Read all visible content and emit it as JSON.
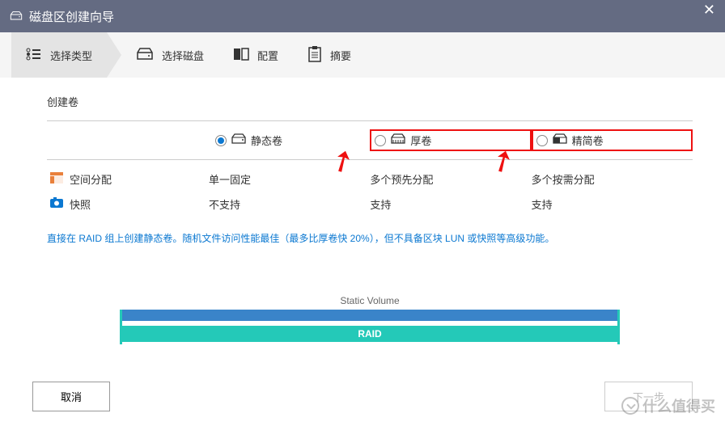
{
  "header": {
    "title": "磁盘区创建向导"
  },
  "steps": [
    {
      "id": "type",
      "label": "选择类型",
      "active": true
    },
    {
      "id": "disk",
      "label": "选择磁盘"
    },
    {
      "id": "config",
      "label": "配置"
    },
    {
      "id": "summary",
      "label": "摘要"
    }
  ],
  "section": {
    "title": "创建卷"
  },
  "volumes": [
    {
      "id": "static",
      "label": "静态卷",
      "selected": true,
      "highlight": false
    },
    {
      "id": "thick",
      "label": "厚卷",
      "selected": false,
      "highlight": true
    },
    {
      "id": "thin",
      "label": "精简卷",
      "selected": false,
      "highlight": true
    }
  ],
  "rows": [
    {
      "icon": "layout-icon",
      "icon_color": "#e9803b",
      "label": "空间分配",
      "cells": [
        "单一固定",
        "多个预先分配",
        "多个按需分配"
      ]
    },
    {
      "icon": "camera-icon",
      "icon_color": "#0b78d1",
      "label": "快照",
      "cells": [
        "不支持",
        "支持",
        "支持"
      ]
    }
  ],
  "desc": "直接在 RAID 组上创建静态卷。随机文件访问性能最佳（最多比厚卷快 20%），但不具备区块 LUN 或快照等高级功能。",
  "diagram": {
    "top_label": "Static Volume",
    "bottom_label": "RAID"
  },
  "footer": {
    "cancel": "取消",
    "next": "下一步"
  },
  "watermark": "什么值得买"
}
